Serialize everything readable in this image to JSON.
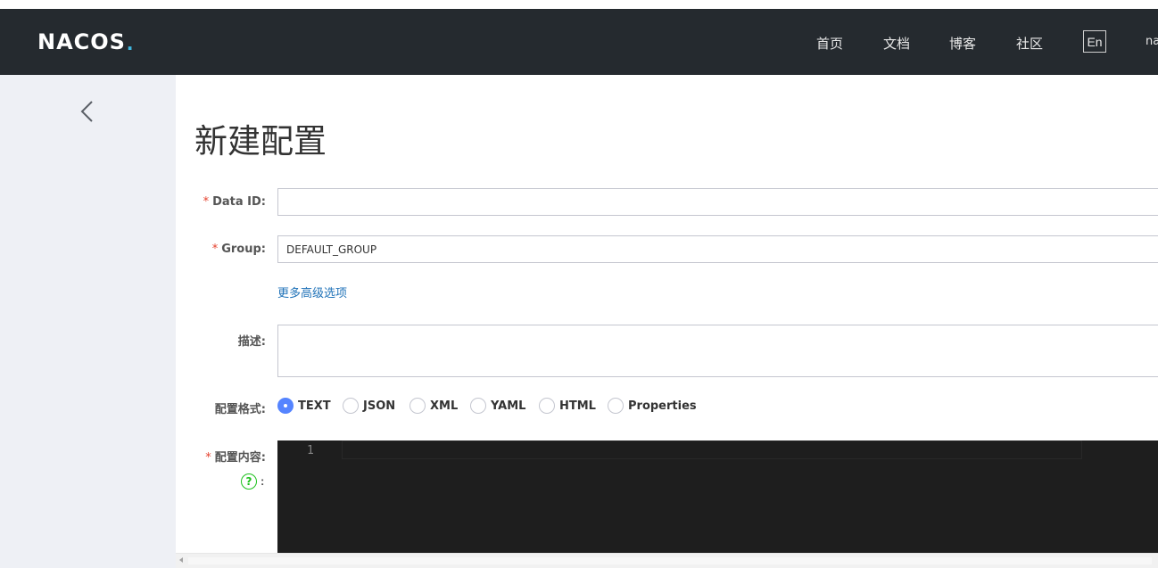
{
  "header": {
    "logo_text": "NACOS",
    "logo_dot": ".",
    "nav": [
      {
        "label": "首页"
      },
      {
        "label": "文档"
      },
      {
        "label": "博客"
      },
      {
        "label": "社区"
      }
    ],
    "lang_button": "En",
    "user_truncated": "na"
  },
  "page": {
    "title": "新建配置"
  },
  "form": {
    "data_id": {
      "label": "Data ID:",
      "required_mark": "*",
      "value": ""
    },
    "group": {
      "label": "Group:",
      "required_mark": "*",
      "value": "DEFAULT_GROUP"
    },
    "advanced_link": "更多高级选项",
    "description": {
      "label": "描述:",
      "value": ""
    },
    "format": {
      "label": "配置格式:",
      "options": [
        "TEXT",
        "JSON",
        "XML",
        "YAML",
        "HTML",
        "Properties"
      ],
      "selected": "TEXT"
    },
    "content": {
      "label": "配置内容:",
      "required_mark": "*",
      "help_icon": "?",
      "help_colon": ":",
      "line_number": "1"
    }
  },
  "colors": {
    "header_bg": "#252a2f",
    "sidebar_bg": "#eef0f5",
    "accent": "#5584ff",
    "link": "#1f72b8",
    "required": "#e5412d",
    "help": "#1dc11d",
    "editor_bg": "#1e1e1e"
  }
}
